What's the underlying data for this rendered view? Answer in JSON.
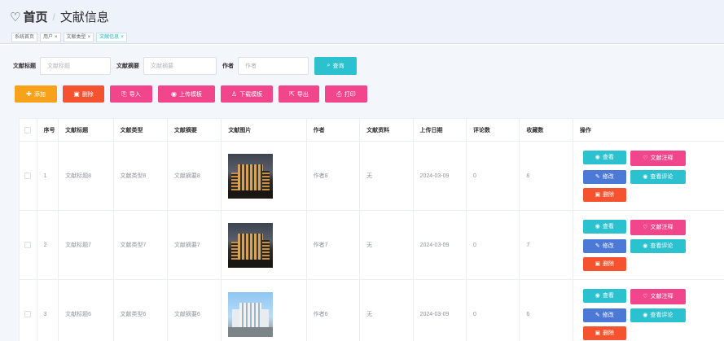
{
  "header": {
    "heart_icon": "heart-outline-icon",
    "home": "首页",
    "separator": "/",
    "current": "文献信息"
  },
  "tags": [
    {
      "label": "系统首页",
      "closable": false,
      "active": false
    },
    {
      "label": "用户",
      "closable": true,
      "active": false
    },
    {
      "label": "文献类型",
      "closable": true,
      "active": false
    },
    {
      "label": "文献信息",
      "closable": true,
      "active": true
    }
  ],
  "search": {
    "title_label": "文献标题",
    "title_placeholder": "文献标题",
    "abstract_label": "文献摘要",
    "abstract_placeholder": "文献摘要",
    "author_label": "作者",
    "author_placeholder": "作者",
    "query_label": "查询"
  },
  "toolbar": {
    "add": "添加",
    "delete": "删除",
    "import": "导入",
    "upload_template": "上传模板",
    "download_template": "下载模板",
    "export": "导出",
    "print": "打印"
  },
  "columns": [
    "序号",
    "文献标题",
    "文献类型",
    "文献摘要",
    "文献图片",
    "作者",
    "文献资料",
    "上传日期",
    "评论数",
    "收藏数",
    "操作"
  ],
  "rows": [
    {
      "index": "1",
      "title": "文献标题8",
      "type": "文献类型8",
      "abstract": "文献摘要8",
      "image": "dusk",
      "author": "作者8",
      "material": "无",
      "date": "2024-03-09",
      "comments": "0",
      "favorites": "8"
    },
    {
      "index": "2",
      "title": "文献标题7",
      "type": "文献类型7",
      "abstract": "文献摘要7",
      "image": "dusk",
      "author": "作者7",
      "material": "无",
      "date": "2024-03-09",
      "comments": "0",
      "favorites": "7"
    },
    {
      "index": "3",
      "title": "文献标题6",
      "type": "文献类型6",
      "abstract": "文献摘要6",
      "image": "day",
      "author": "作者6",
      "material": "无",
      "date": "2024-03-09",
      "comments": "0",
      "favorites": "6"
    }
  ],
  "actions": {
    "view": "查看",
    "note": "文献注释",
    "edit": "修改",
    "view_comments": "查看评论",
    "delete": "删除"
  },
  "colors": {
    "cyan": "#2cc1cf",
    "orange": "#f7a21b",
    "red": "#f5532f",
    "pink": "#f2468c",
    "blue": "#4d79d6"
  }
}
